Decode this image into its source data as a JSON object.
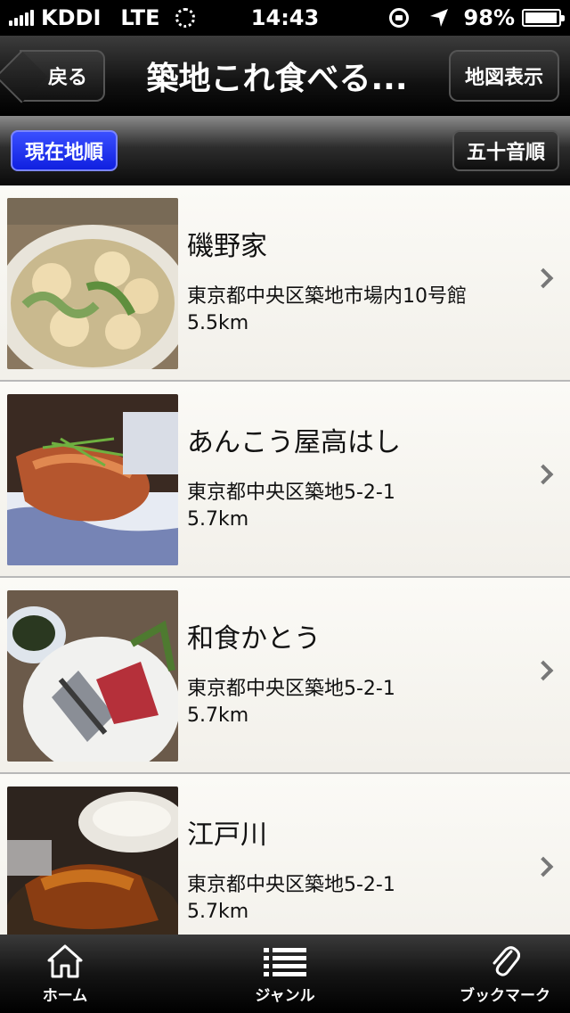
{
  "status_bar": {
    "carrier": "KDDI",
    "network": "LTE",
    "time": "14:43",
    "battery": "98%",
    "battery_level": 0.98
  },
  "nav": {
    "back_label": "戻る",
    "title": "築地これ食べる...",
    "map_label": "地図表示"
  },
  "sort": {
    "current_label": "現在地順",
    "alpha_label": "五十音順",
    "active": "current"
  },
  "items": [
    {
      "name": "磯野家",
      "address": "東京都中央区築地市場内10号館",
      "distance": "5.5km"
    },
    {
      "name": "あんこう屋高はし",
      "address": "東京都中央区築地5-2-1",
      "distance": "5.7km"
    },
    {
      "name": "和食かとう",
      "address": "東京都中央区築地5-2-1",
      "distance": "5.7km"
    },
    {
      "name": "江戸川",
      "address": "東京都中央区築地5-2-1",
      "distance": "5.7km"
    }
  ],
  "tabs": [
    {
      "label": "ホーム",
      "icon": "home-icon"
    },
    {
      "label": "ジャンル",
      "icon": "list-icon"
    },
    {
      "label": "ブックマーク",
      "icon": "paperclip-icon"
    }
  ]
}
